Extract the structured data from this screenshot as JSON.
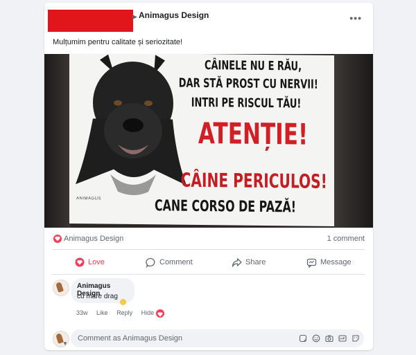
{
  "post": {
    "author": "Animagus Design",
    "caption": "Mulțumim pentru calitate și seriozitate!",
    "more_label": "•••"
  },
  "photo": {
    "sign_lines": [
      "CÂINELE NU E RĂU,",
      "DAR STĂ PROST CU NERVII!",
      "INTRI PE RISCUL TĂU!",
      "ATENȚIE!",
      "CÂINE PERICULOS!",
      "CANE CORSO DE PAZĂ!"
    ],
    "brand_mark": "ANIMAGUS"
  },
  "stats": {
    "reaction_name": "Animagus Design",
    "comments_count": "1 comment"
  },
  "actions": {
    "love": "Love",
    "comment": "Comment",
    "share": "Share",
    "message": "Message"
  },
  "comment": {
    "author": "Animagus Design",
    "text": "cu mare drag",
    "age": "33w",
    "like": "Like",
    "reply": "Reply",
    "hide": "Hide"
  },
  "composer": {
    "placeholder": "Comment as Animagus Design"
  },
  "colors": {
    "love_accent": "#f33e58",
    "sign_red": "#d01f25",
    "redaction": "#e0161b",
    "background": "#f0f2f5"
  },
  "icons": {
    "more": "more-horizontal-icon",
    "love": "heart-icon",
    "comment": "speech-bubble-icon",
    "share": "share-arrow-icon",
    "message": "messenger-icon",
    "composer": [
      "sticker-icon",
      "emoji-icon",
      "camera-icon",
      "gif-icon",
      "sticker-smile-icon"
    ]
  }
}
